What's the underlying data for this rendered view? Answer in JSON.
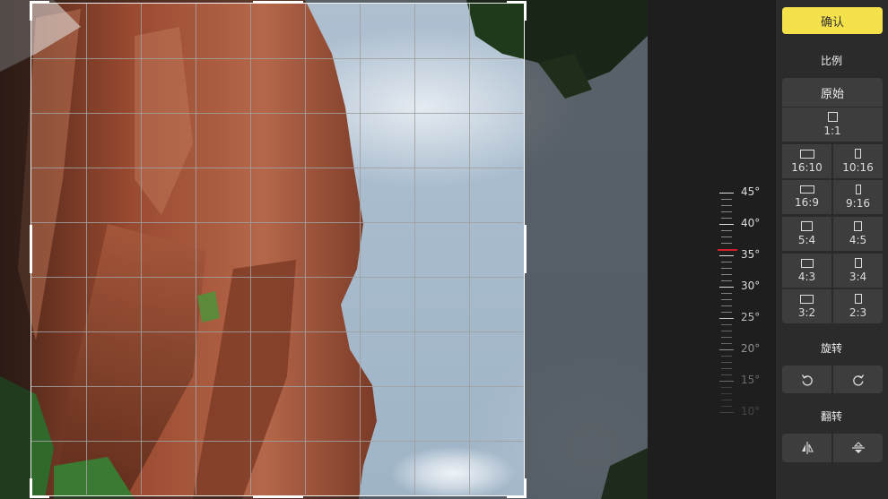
{
  "panel": {
    "confirm_label": "确认",
    "ratio_title": "比例",
    "rotate_title": "旋转",
    "flip_title": "翻转",
    "ratios": {
      "original": "原始",
      "r1_1": "1:1",
      "r16_10": "16:10",
      "r10_16": "10:16",
      "r16_9": "16:9",
      "r9_16": "9:16",
      "r5_4": "5:4",
      "r4_5": "4:5",
      "r4_3": "4:3",
      "r3_4": "3:4",
      "r3_2": "3:2",
      "r2_3": "2:3"
    }
  },
  "ruler": {
    "labels": [
      "45°",
      "40°",
      "35°",
      "30°",
      "25°",
      "20°",
      "15°",
      "10°"
    ],
    "current_angle": 38
  },
  "colors": {
    "accent": "#f5e14a",
    "indicator": "#d0202a",
    "panel_bg": "#2b2b2b",
    "button_bg": "#3d3d3d"
  }
}
